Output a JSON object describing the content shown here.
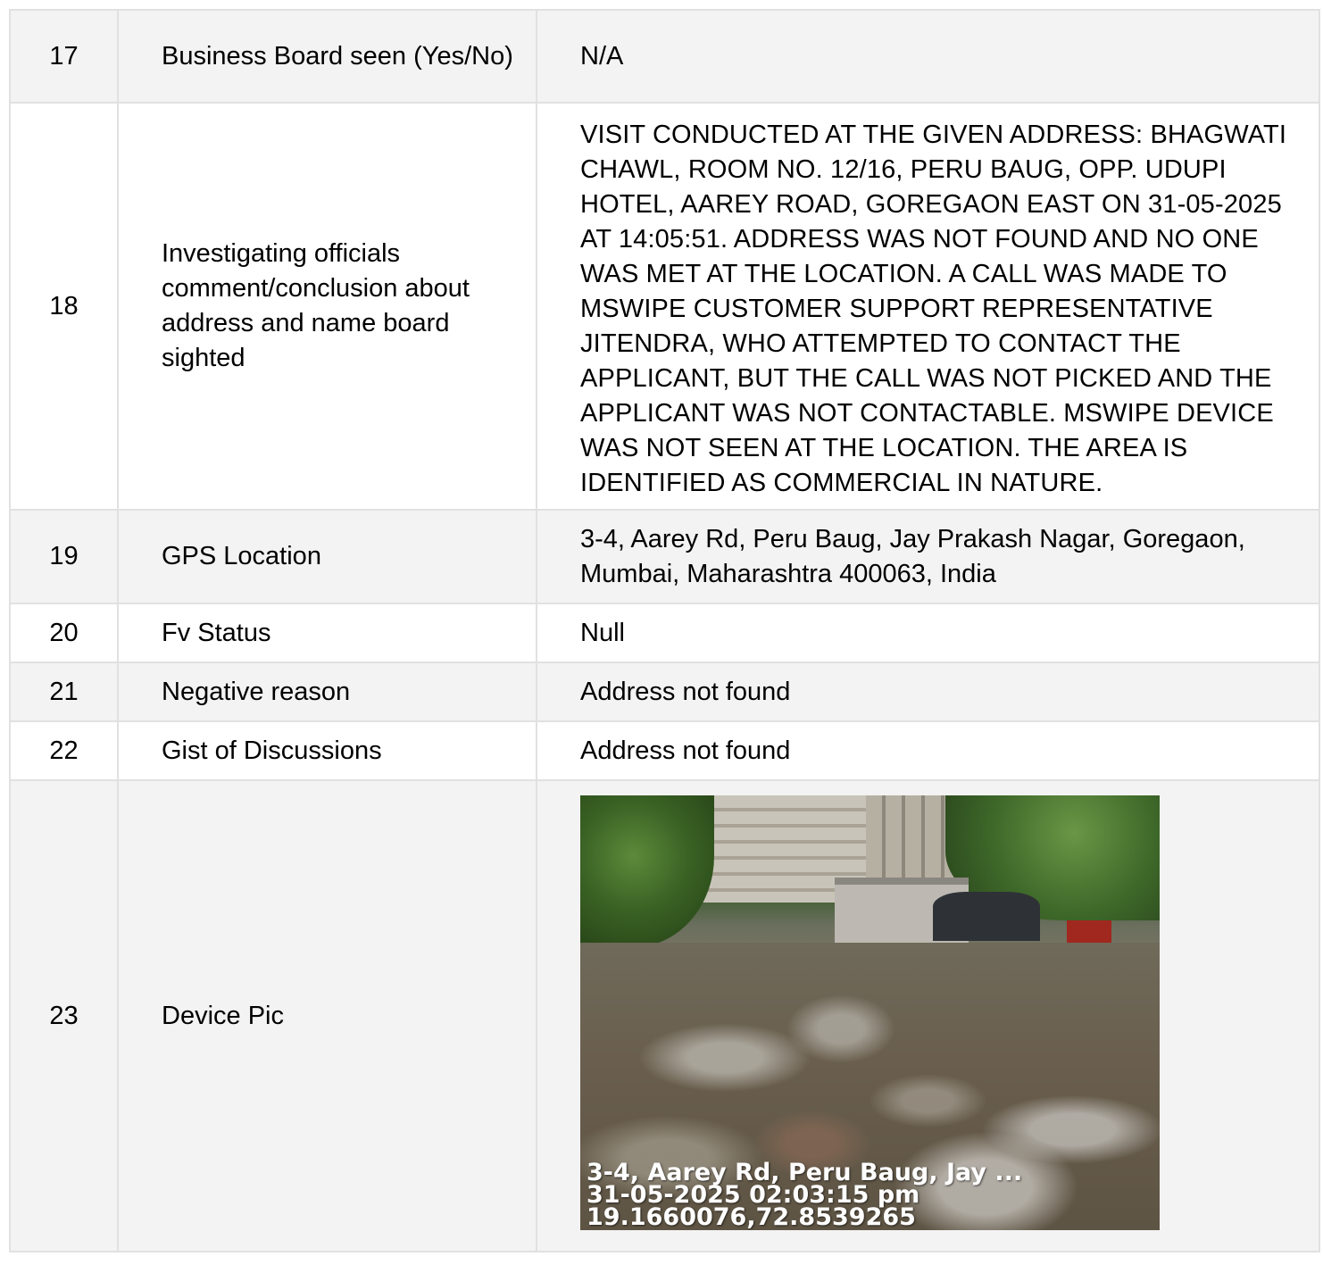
{
  "rows": [
    {
      "no": "17",
      "label": "Business Board seen (Yes/No)",
      "value": "N/A"
    },
    {
      "no": "18",
      "label": "Investigating officials comment/conclusion about address and name board sighted",
      "value": "VISIT CONDUCTED AT THE GIVEN ADDRESS: BHAGWATI CHAWL, ROOM NO. 12/16, PERU BAUG, OPP. UDUPI HOTEL, AAREY ROAD, GOREGAON EAST ON 31-05-2025 AT 14:05:51. ADDRESS WAS NOT FOUND AND NO ONE WAS MET AT THE LOCATION. A CALL WAS MADE TO MSWIPE CUSTOMER SUPPORT REPRESENTATIVE JITENDRA, WHO ATTEMPTED TO CONTACT THE APPLICANT, BUT THE CALL WAS NOT PICKED AND THE APPLICANT WAS NOT CONTACTABLE. MSWIPE DEVICE WAS NOT SEEN AT THE LOCATION. THE AREA IS IDENTIFIED AS COMMERCIAL IN NATURE."
    },
    {
      "no": "19",
      "label": "GPS Location",
      "value": "3-4, Aarey Rd, Peru Baug, Jay Prakash Nagar, Goregaon, Mumbai, Maharashtra 400063, India"
    },
    {
      "no": "20",
      "label": "Fv Status",
      "value": "Null"
    },
    {
      "no": "21",
      "label": "Negative reason",
      "value": "Address not found"
    },
    {
      "no": "22",
      "label": "Gist of Discussions",
      "value": "Address not found"
    },
    {
      "no": "23",
      "label": "Device Pic",
      "photo": {
        "stamp_address": "3-4, Aarey Rd, Peru Baug, Jay ...",
        "stamp_datetime": "31-05-2025 02:03:15 pm",
        "stamp_coords": "19.1660076,72.8539265"
      }
    }
  ],
  "colors": {
    "row_shaded": "#f3f3f3",
    "row_plain": "#ffffff",
    "border": "#e1e1e1",
    "text": "#000000"
  }
}
